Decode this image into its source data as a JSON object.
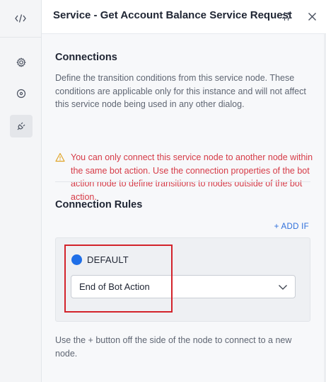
{
  "header": {
    "title": "Service - Get Account Balance Service Request"
  },
  "rail": {
    "items": [
      {
        "icon": "code-icon"
      },
      {
        "icon": "gear-icon"
      },
      {
        "icon": "target-icon"
      },
      {
        "icon": "plug-icon",
        "active": true
      }
    ]
  },
  "connections": {
    "title": "Connections",
    "description": "Define the transition conditions from this service node. These conditions are applicable only for this instance and will not affect this service node being used in any other dialog.",
    "warning": "You can only connect this service node to another node within the same bot action. Use the connection properties of the bot action node to define transitions to nodes outside of the bot action."
  },
  "connection_rules": {
    "title": "Connection Rules",
    "add_if": "+ ADD IF",
    "default_label": "DEFAULT",
    "default_target": "End of Bot Action",
    "footnote": "Use the + button off the side of the node to connect to a new node."
  },
  "colors": {
    "accent": "#1f6fe8",
    "warning": "#d63b47",
    "highlight": "#d3232b"
  }
}
